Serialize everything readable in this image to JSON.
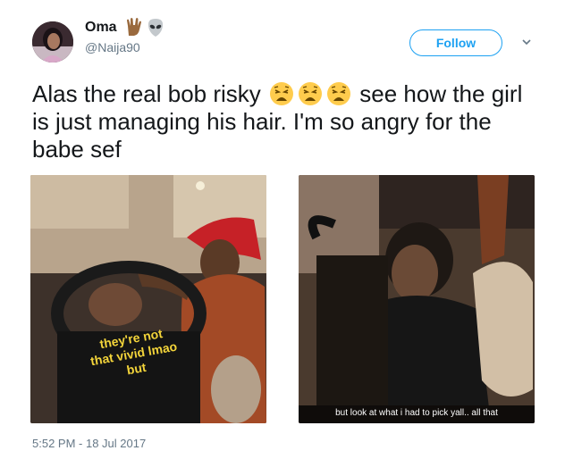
{
  "user": {
    "display_name": "Oma",
    "username": "@Naija90",
    "name_emojis": [
      "vulcan-salute-emoji",
      "alien-emoji"
    ]
  },
  "follow": {
    "label": "Follow"
  },
  "tweet": {
    "text_part1": "Alas the real bob risky",
    "emojis": [
      "weary-face-emoji",
      "weary-face-emoji",
      "weary-face-emoji"
    ],
    "text_part2": "see how the girl is just managing his hair. I'm so angry for the babe sef"
  },
  "photos": {
    "left_caption": "they're not that vivid lmao but",
    "right_caption": "but look at what i had to pick yall.. all that"
  },
  "timestamp": "5:52 PM - 18 Jul 2017",
  "colors": {
    "accent": "#1da1f2",
    "secondary_text": "#657786",
    "caption_yellow": "#f3d43a"
  }
}
